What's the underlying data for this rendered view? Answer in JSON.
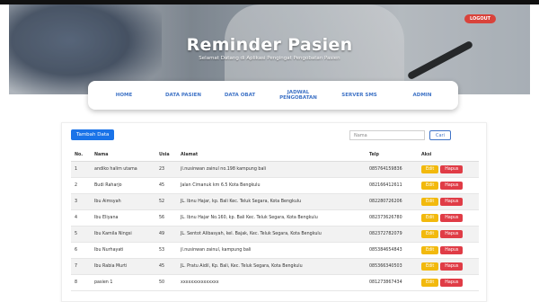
{
  "header": {
    "title": "Reminder Pasien",
    "subtitle": "Selamat Datang di Aplikasi Pengingat Pengobatan Pasien",
    "logout_label": "LOGOUT"
  },
  "nav": {
    "items": [
      "HOME",
      "DATA PASIEN",
      "DATA OBAT",
      "JADWAL PENGOBATAN",
      "SERVER SMS",
      "ADMIN"
    ]
  },
  "toolbar": {
    "add_label": "Tambah Data",
    "search_placeholder": "Nama",
    "search_button": "Cari"
  },
  "table": {
    "columns": [
      "No.",
      "Nama",
      "Usia",
      "Alamat",
      "Telp",
      "Aksi"
    ],
    "edit_label": "Edit",
    "delete_label": "Hapus",
    "rows": [
      {
        "no": "1",
        "nama": "andiko halim utama",
        "usia": "23",
        "alamat": "jl.nusinwan zainul no.198 kampung bali",
        "telp": "085764159836"
      },
      {
        "no": "2",
        "nama": "Budi Raharjo",
        "usia": "45",
        "alamat": "Jalan Cimanuk km 6.5 Kota Bengkulu",
        "telp": "082166412611"
      },
      {
        "no": "3",
        "nama": "Ibu Aimsyah",
        "usia": "52",
        "alamat": "JL. Ibnu Hajar, kp. Bali Kec. Teluk Segara, Kota Bengkulu",
        "telp": "082280726206"
      },
      {
        "no": "4",
        "nama": "Ibu Eliyana",
        "usia": "56",
        "alamat": "JL. Ibnu Hajar No.160, kp. Bali Kec. Teluk Segara, Kota Bengkulu",
        "telp": "082373626780"
      },
      {
        "no": "5",
        "nama": "Ibu Kamila Ningsi",
        "usia": "49",
        "alamat": "JL. Sentot Alibasyah, kel. Bajak, Kec. Teluk Segara, Kota Bengkulu",
        "telp": "082372782079"
      },
      {
        "no": "6",
        "nama": "Ibu Nurhayati",
        "usia": "53",
        "alamat": "jl.nusinwan zainul, kampung bali",
        "telp": "085384654843"
      },
      {
        "no": "7",
        "nama": "Ibu Rabia Murti",
        "usia": "45",
        "alamat": "JL. Pratu Aidil, Kp. Bali, Kec. Teluk Segara, Kota Bengkulu",
        "telp": "085366340503"
      },
      {
        "no": "8",
        "nama": "pasien 1",
        "usia": "50",
        "alamat": "xxxxxxxxxxxxxxx",
        "telp": "081273867434"
      }
    ]
  },
  "colors": {
    "accent": "#3f73c6",
    "primary_button": "#1a73e8",
    "edit": "#f2b90d",
    "delete": "#e03c46",
    "logout": "#d9433b"
  }
}
